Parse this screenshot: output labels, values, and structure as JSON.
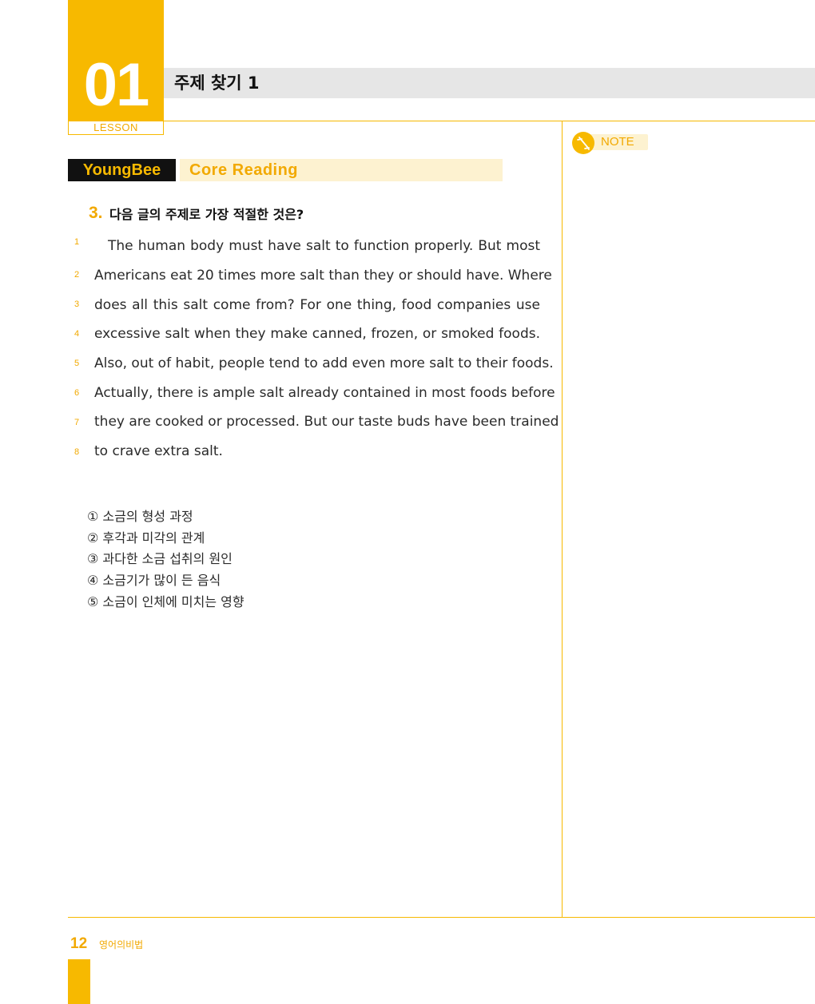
{
  "lesson": {
    "number": "01",
    "label": "LESSON",
    "title": "주제 찾기 1"
  },
  "brand": {
    "name": "YoungBee",
    "section": "Core Reading"
  },
  "question": {
    "number": "3.",
    "prompt": "다음 글의 주제로 가장 적절한 것은?"
  },
  "passage": [
    {
      "n": "1",
      "text": "The human body must have salt to function properly. But most"
    },
    {
      "n": "2",
      "text": "Americans eat 20 times more salt than they or should have. Where"
    },
    {
      "n": "3",
      "text": "does all this salt come from? For one thing, food companies use"
    },
    {
      "n": "4",
      "text": "excessive salt when they make canned, frozen, or smoked foods."
    },
    {
      "n": "5",
      "text": "Also, out of habit, people tend to add even more salt to their foods."
    },
    {
      "n": "6",
      "text": "Actually, there is ample salt already contained in most foods before"
    },
    {
      "n": "7",
      "text": "they are cooked or processed. But our taste buds have been trained"
    },
    {
      "n": "8",
      "text": "to crave extra salt."
    }
  ],
  "options": [
    "① 소금의 형성 과정",
    "② 후각과 미각의 관계",
    "③ 과다한 소금 섭취의 원인",
    "④ 소금기가 많이 든 음식",
    "⑤ 소금이 인체에 미치는 영향"
  ],
  "note": {
    "label": "NOTE",
    "icon": "pencil-icon"
  },
  "footer": {
    "page": "12",
    "book_title": "영어의비법"
  },
  "colors": {
    "accent": "#f7b900",
    "accent_text": "#f2a900",
    "title_bar": "#e6e6e6",
    "brand_bg": "#111111",
    "tint": "#fdf2d0"
  }
}
